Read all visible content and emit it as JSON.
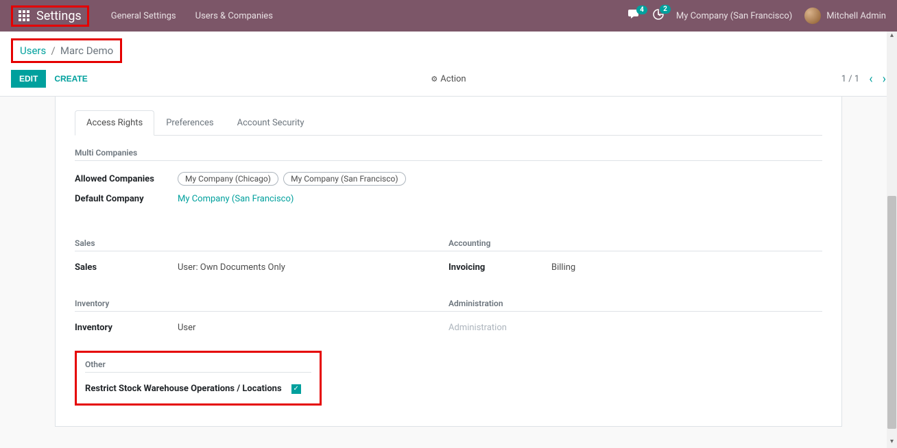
{
  "topbar": {
    "brand": "Settings",
    "menu": [
      "General Settings",
      "Users & Companies"
    ],
    "chat_badge": "4",
    "activity_badge": "2",
    "company": "My Company (San Francisco)",
    "user": "Mitchell Admin"
  },
  "breadcrumb": {
    "root": "Users",
    "sep": "/",
    "current": "Marc Demo"
  },
  "toolbar": {
    "edit": "EDIT",
    "create": "CREATE",
    "action": "Action",
    "pager": "1 / 1"
  },
  "tabs": [
    "Access Rights",
    "Preferences",
    "Account Security"
  ],
  "sections": {
    "multi_companies": {
      "title": "Multi Companies",
      "allowed_label": "Allowed Companies",
      "allowed_tags": [
        "My Company (Chicago)",
        "My Company (San Francisco)"
      ],
      "default_label": "Default Company",
      "default_value": "My Company (San Francisco)"
    },
    "sales": {
      "title": "Sales",
      "label": "Sales",
      "value": "User: Own Documents Only"
    },
    "accounting": {
      "title": "Accounting",
      "label": "Invoicing",
      "value": "Billing"
    },
    "inventory": {
      "title": "Inventory",
      "label": "Inventory",
      "value": "User"
    },
    "administration": {
      "title": "Administration",
      "label": "Administration",
      "value": ""
    },
    "other": {
      "title": "Other",
      "restrict_label": "Restrict Stock Warehouse Operations / Locations",
      "restrict_checked": true
    }
  }
}
